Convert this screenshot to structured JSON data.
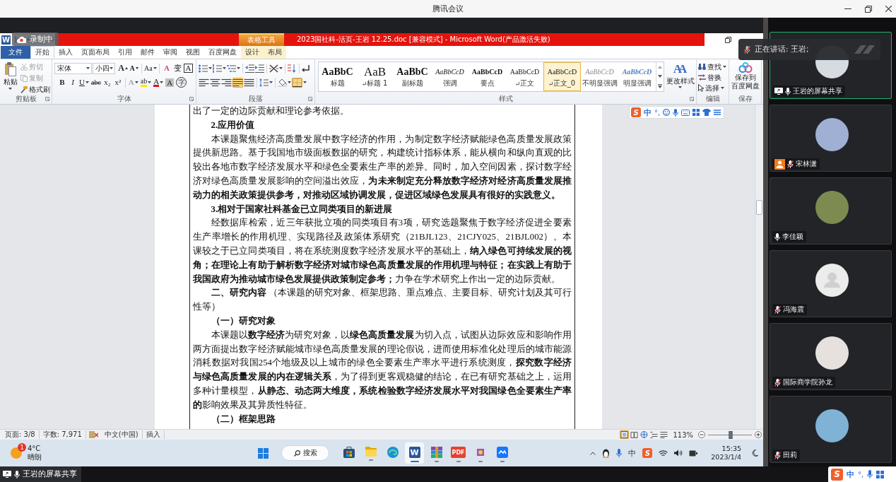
{
  "meeting_window": {
    "title": "腾讯会议"
  },
  "recording_badge": {
    "label": "录制中"
  },
  "speaking_banner": {
    "text": "正在讲话: 王岩;",
    "muted": true
  },
  "word": {
    "logo": "W",
    "contextual_group": "表格工具",
    "title": "2023国社科-活页-王岩 12.25.doc [兼容模式] - Microsoft Word(产品激活失败)",
    "tabs": [
      {
        "label": "文件",
        "kind": "file",
        "selected": false
      },
      {
        "label": "开始",
        "kind": "normal",
        "selected": true
      },
      {
        "label": "插入",
        "kind": "normal",
        "selected": false
      },
      {
        "label": "页面布局",
        "kind": "normal",
        "selected": false
      },
      {
        "label": "引用",
        "kind": "normal",
        "selected": false
      },
      {
        "label": "邮件",
        "kind": "normal",
        "selected": false
      },
      {
        "label": "审阅",
        "kind": "normal",
        "selected": false
      },
      {
        "label": "视图",
        "kind": "normal",
        "selected": false
      },
      {
        "label": "百度网盘",
        "kind": "normal",
        "selected": false
      },
      {
        "label": "设计",
        "kind": "contextual",
        "selected": false
      },
      {
        "label": "布局",
        "kind": "contextual",
        "selected": false
      }
    ],
    "ribbon": {
      "clipboard": {
        "label": "剪贴板",
        "paste": "粘贴",
        "tools": [
          {
            "label": "剪切",
            "kind": "cut",
            "disabled": true
          },
          {
            "label": "复制",
            "kind": "copy",
            "disabled": true
          },
          {
            "label": "格式刷",
            "kind": "format_painter",
            "disabled": false
          }
        ]
      },
      "font": {
        "label": "字体",
        "font_name": "宋体",
        "font_size": "小四",
        "row_1": [
          {
            "glyph": "A",
            "kind": "grow"
          },
          {
            "glyph": "A",
            "kind": "shrink"
          },
          {
            "glyph": "Aa",
            "kind": "case"
          },
          {
            "glyph": "A",
            "kind": "clear"
          },
          {
            "glyph": "变",
            "kind": "phonetic"
          },
          {
            "glyph": "A",
            "kind": "border"
          }
        ],
        "row_2": [
          {
            "glyph": "B",
            "kind": "bold"
          },
          {
            "glyph": "I",
            "kind": "italic"
          },
          {
            "glyph": "U",
            "kind": "underline"
          },
          {
            "glyph": "abc",
            "kind": "strike"
          },
          {
            "glyph": "x₂",
            "kind": "subscript"
          },
          {
            "glyph": "x²",
            "kind": "superscript"
          },
          {
            "glyph": "A",
            "kind": "effects"
          },
          {
            "glyph": "ab",
            "kind": "highlight"
          },
          {
            "glyph": "A",
            "kind": "color"
          },
          {
            "glyph": "A",
            "kind": "shading"
          },
          {
            "glyph": "字",
            "kind": "enclose"
          }
        ]
      },
      "paragraph": {
        "label": "段落",
        "alignment": [
          {
            "kind": "left",
            "selected": false
          },
          {
            "kind": "center",
            "selected": false
          },
          {
            "kind": "right",
            "selected": false
          },
          {
            "kind": "justify",
            "selected": true
          },
          {
            "kind": "distributed",
            "selected": false
          }
        ],
        "borders_selected": true
      },
      "styles": {
        "label": "样式",
        "items": [
          {
            "sample": "AaBbC",
            "label": "标题",
            "kind": "title",
            "paragraph_mark": false,
            "selected": false
          },
          {
            "sample": "AaB",
            "label": "标题 1",
            "kind": "heading1",
            "paragraph_mark": true,
            "selected": false
          },
          {
            "sample": "AaBbC",
            "label": "副标题",
            "kind": "subtitle",
            "paragraph_mark": false,
            "selected": false
          },
          {
            "sample": "AaBbCcD",
            "label": "强调",
            "kind": "emphasis",
            "paragraph_mark": false,
            "selected": false
          },
          {
            "sample": "AaBbCcD",
            "label": "要点",
            "kind": "strong",
            "paragraph_mark": false,
            "selected": false
          },
          {
            "sample": "AaBbCcD",
            "label": "正文",
            "kind": "normal",
            "paragraph_mark": true,
            "selected": false
          },
          {
            "sample": "AaBbCcD",
            "label": "正文_0",
            "kind": "normal",
            "paragraph_mark": true,
            "selected": true
          },
          {
            "sample": "AaBbCcD",
            "label": "不明显强调",
            "kind": "subtle",
            "paragraph_mark": false,
            "selected": false
          },
          {
            "sample": "AaBbCcD",
            "label": "明显强调",
            "kind": "intense",
            "paragraph_mark": false,
            "selected": false
          }
        ],
        "change_styles": {
          "glyph": "AA",
          "label": "更改样式"
        }
      },
      "editing": {
        "label": "编辑",
        "items": [
          {
            "label": "查找",
            "kind": "find"
          },
          {
            "label": "替换",
            "kind": "replace"
          },
          {
            "label": "选择",
            "kind": "select"
          }
        ]
      },
      "save": {
        "label": "保存",
        "button": [
          "保存到",
          "百度网盘"
        ]
      }
    },
    "ime_toolbar": {
      "logo": "S",
      "mode": "中",
      "punctuation": "°,"
    },
    "document": {
      "paragraphs": [
        {
          "kind": "continuation",
          "text": "出了一定的边际贡献和理论参考依据。"
        },
        {
          "kind": "heading",
          "text": "2.应用价值"
        },
        {
          "kind": "body",
          "text": "本课题聚焦经济高质量发展中数字经济的作用，为制定数字经济赋能绿色高质量发展政策提供新思路。基于我国地市级面板数据的研究，构建统计指标体系，能从横向和纵向直观的比较出各地市数字经济发展水平和绿色全要素生产率的差异。同时，加入空间因素，探讨数字经济对绿色高质量发展影响的空间溢出效应，**为未来制定充分释放数字经济对经济高质量发展推动力的相关政策提供参考，对推动区域协调发展，促进区域绿色发展具有很好的实践意义。**"
        },
        {
          "kind": "heading",
          "text": "3.相对于国家社科基金已立同类项目的新进展"
        },
        {
          "kind": "body",
          "text": "经数据库检索，近三年获批立项的同类项目有3项，研究选题聚焦于数字经济促进全要素生产率增长的作用机理、实现路径及政策体系研究（21BJL123、21CJY025、21BJL002）。本课较之于已立同类项目，将在系统测度数字经济发展水平的基础上，**纳入绿色可持续发展的视角；在理论上有助于解析数字经济对城市绿色高质量发展的作用机理与特征；在实践上有助于我国政府为推动城市绿色发展提供政策制定参考；**力争在学术研究上作出一定的边际贡献。"
        },
        {
          "kind": "body",
          "text": "**二、研究内容** （本课题的研究对象、框架思路、重点难点、主要目标、研究计划及其可行性等）"
        },
        {
          "kind": "heading",
          "text": "（一）研究对象"
        },
        {
          "kind": "body",
          "text": "本课题以**数字经济**为研究对象，以**绿色高质量发展**为切入点，试图从边际效应和影响作用两方面提出数字经济赋能城市绿色高质量发展的理论假说，进而使用标准化处理后的城市能源消耗数据对我国254个地级及以上城市的绿色全要素生产率水平进行系统测度，**探究数字经济与绿色高质量发展的内在逻辑关系**，为了得到更客观稳健的结论，在已有研究基础之上，运用多种计量模型，**从静态、动态两大维度，系统检验数字经济发展水平对我国绿色全要素生产率的**影响效果及其异质性特征。"
        },
        {
          "kind": "heading",
          "text": "（二）框架思路"
        }
      ]
    },
    "status_bar": {
      "page": "页面: 3/8",
      "word_count": "字数: 7,971",
      "language": "中文(中国)",
      "input_mode": "插入",
      "views": [
        {
          "kind": "print",
          "selected": true
        },
        {
          "kind": "reading",
          "selected": false
        },
        {
          "kind": "web",
          "selected": false
        },
        {
          "kind": "outline",
          "selected": false
        },
        {
          "kind": "draft",
          "selected": false
        }
      ],
      "zoom": {
        "reading": "113%",
        "level": 0.52
      }
    }
  },
  "taskbar": {
    "weather": {
      "badge": "1",
      "temperature": "4°C",
      "condition": "晴朗"
    },
    "search": "搜索",
    "apps": [
      {
        "kind": "store",
        "running": false,
        "selected": false
      },
      {
        "kind": "explorer",
        "running": true,
        "selected": false
      },
      {
        "kind": "edge",
        "running": false,
        "selected": false
      },
      {
        "kind": "word",
        "glyph": "W",
        "running": true,
        "selected": true
      },
      {
        "kind": "archive",
        "running": true,
        "selected": false
      },
      {
        "kind": "pdf",
        "glyph": "PDF",
        "running": true,
        "selected": false
      },
      {
        "kind": "paint",
        "running": true,
        "selected": false
      },
      {
        "kind": "meeting",
        "running": true,
        "selected": false
      }
    ],
    "ime": "中",
    "ime_logo": "S",
    "time": "15:35",
    "date": "2023/1/4"
  },
  "participants": [
    {
      "name": "王岩的屏幕共享",
      "kind": "photo",
      "muted": false,
      "sharing": true,
      "host": false,
      "speaking": true
    },
    {
      "name": "宋林潇",
      "kind": "photo",
      "muted": true,
      "sharing": false,
      "host": true,
      "speaking": false
    },
    {
      "name": "李佳颖",
      "kind": "photo",
      "muted": false,
      "sharing": false,
      "host": false,
      "speaking": false
    },
    {
      "name": "冯海震",
      "kind": "default",
      "muted": true,
      "sharing": false,
      "host": false,
      "speaking": false
    },
    {
      "name": "国际商学院孙龙",
      "kind": "photo",
      "muted": true,
      "sharing": false,
      "host": false,
      "speaking": false
    },
    {
      "name": "田莉",
      "kind": "photo",
      "muted": true,
      "sharing": false,
      "host": false,
      "speaking": false
    }
  ],
  "share_label": {
    "text": "王岩的屏幕共享"
  },
  "ime_bar": {
    "logo": "S",
    "mode": "中",
    "punctuation": "°,"
  }
}
